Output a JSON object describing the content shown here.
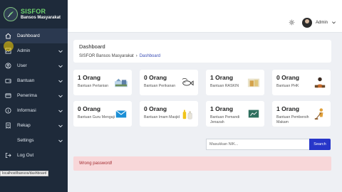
{
  "brand": {
    "name": "SISFOR",
    "subtitle": "Bansos Masyarakat"
  },
  "sidebar": {
    "items": [
      {
        "label": "Dashboard",
        "icon": "home-icon",
        "active": true,
        "has_chevron": false
      },
      {
        "label": "Admin",
        "icon": "chart-icon",
        "active": false,
        "has_chevron": true
      },
      {
        "label": "User",
        "icon": "user-icon",
        "active": false,
        "has_chevron": true
      },
      {
        "label": "Bantuan",
        "icon": "wallet-icon",
        "active": false,
        "has_chevron": true
      },
      {
        "label": "Penerima",
        "icon": "card-icon",
        "active": false,
        "has_chevron": true
      },
      {
        "label": "Informasi",
        "icon": "info-icon",
        "active": false,
        "has_chevron": true
      },
      {
        "label": "Rekap",
        "icon": "receipt-icon",
        "active": false,
        "has_chevron": true
      },
      {
        "label": "Settings",
        "icon": "",
        "active": false,
        "has_chevron": true
      },
      {
        "label": "Log Out",
        "icon": "logout-icon",
        "active": false,
        "has_chevron": false
      }
    ]
  },
  "topbar": {
    "user_name": "Admin"
  },
  "header": {
    "title": "Dashboard",
    "breadcrumb": {
      "home": "SISFOR Bansos Masyarakat",
      "separator": "›",
      "current": "Dashboard"
    }
  },
  "stats": [
    {
      "count": "1 Orang",
      "label": "Bantuan Pertanian",
      "icon": "farm-icon"
    },
    {
      "count": "0 Orang",
      "label": "Bantuan Perikanan",
      "icon": "fish-icon"
    },
    {
      "count": "1 Orang",
      "label": "Bantuan RASKIN",
      "icon": "rice-icon"
    },
    {
      "count": "0 Orang",
      "label": "Bantuan PHK",
      "icon": "worker-icon"
    },
    {
      "count": "0 Orang",
      "label": "Bantuan Guru Mengaji",
      "icon": "mail-icon"
    },
    {
      "count": "0 Orang",
      "label": "Bantuan Imam Masjid",
      "icon": "bottles-icon"
    },
    {
      "count": "1 Orang",
      "label": "Bantuan Pemandi Jenazah",
      "icon": "presentation-icon"
    },
    {
      "count": "1 Orang",
      "label": "Bantuan Pembersih Makam",
      "icon": "sweeper-icon"
    }
  ],
  "search": {
    "placeholder": "Masukkan NIK...",
    "button_label": "Search"
  },
  "alert": {
    "message": "Wrong password!"
  },
  "statusbar": {
    "url": "localhost/bansos/dashboard"
  },
  "colors": {
    "sidebar_bg": "#1e2a3a",
    "brand_green": "#6dd36d",
    "accent": "#2736c9",
    "alert_bg": "#f8d7d9",
    "alert_text": "#a12a2f"
  }
}
